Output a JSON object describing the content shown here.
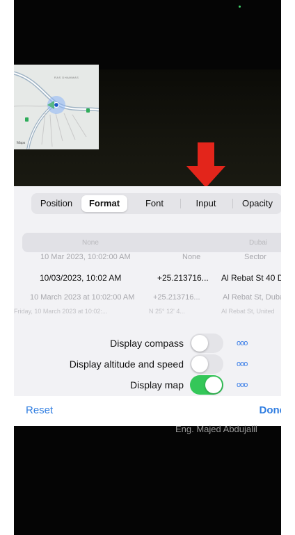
{
  "tabs": [
    {
      "label": "Position",
      "active": false
    },
    {
      "label": "Format",
      "active": true
    },
    {
      "label": "Font",
      "active": false
    },
    {
      "label": "Input",
      "active": false
    },
    {
      "label": "Opacity",
      "active": false
    }
  ],
  "picker_rows": [
    {
      "date": "None",
      "coord": "",
      "address": "Dubai"
    },
    {
      "date": "10 Mar 2023, 10:02:00 AM",
      "coord": "None",
      "address": "Sector"
    },
    {
      "date": "10/03/2023, 10:02 AM",
      "coord": "+25.213716...",
      "address": "Al Rebat St 40 Du"
    },
    {
      "date": "10 March 2023 at 10:02:00 AM",
      "coord": "+25.213716...",
      "address": "Al Rebat St, Duba"
    },
    {
      "date": "Friday, 10 March 2023 at 10:02:...",
      "coord": "N 25° 12' 4...",
      "address": "Al Rebat St, United"
    }
  ],
  "options": [
    {
      "label": "Display compass",
      "on": false,
      "more": "ooo"
    },
    {
      "label": "Display altitude and speed",
      "on": false,
      "more": "ooo"
    },
    {
      "label": "Display map",
      "on": true,
      "more": "ooo"
    }
  ],
  "footer": {
    "reset": "Reset",
    "done": "Done"
  },
  "map": {
    "label": "RAS DHAMMAS",
    "credit": "Maps"
  },
  "overlay_text": "Eng. Majed Abdujalil",
  "colors": {
    "accent": "#2f7de1",
    "toggle_on": "#34c759",
    "arrow": "#e3251b"
  }
}
